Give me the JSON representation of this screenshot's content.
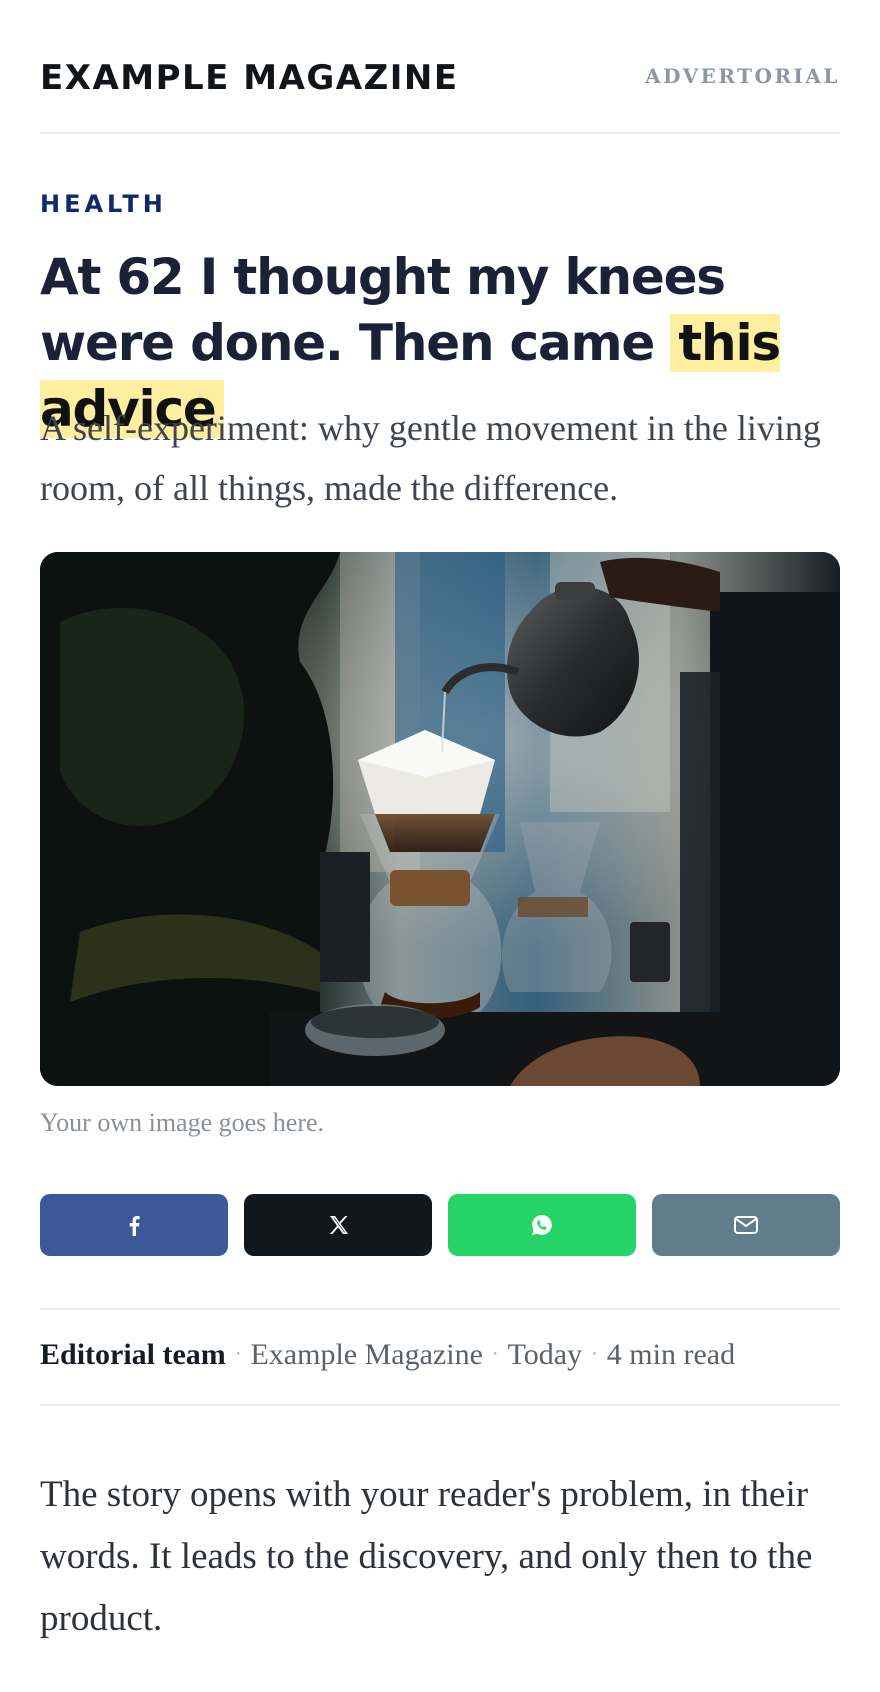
{
  "masthead": {
    "logo": "EXAMPLE MAGAZINE",
    "label": "ADVERTORIAL"
  },
  "article": {
    "kicker": "HEALTH",
    "headline_main": "At 62 I thought my knees were done. Then came",
    "headline_highlight": "this advice",
    "dek": "A self-experiment: why gentle movement in the living room, of all things, made the difference.",
    "caption": "Your own image goes here.",
    "body": "The story opens with your reader's problem, in their words. It leads to the discovery, and only then to the product."
  },
  "share": [
    {
      "icon": "facebook-icon",
      "color": "#3b5998"
    },
    {
      "icon": "x-icon",
      "color": "#12161d"
    },
    {
      "icon": "whatsapp-icon",
      "color": "#25d366"
    },
    {
      "icon": "mail-icon",
      "color": "#607d8b"
    }
  ],
  "byline": {
    "author": "Editorial team",
    "publication": "Example Magazine",
    "date": "Today",
    "read_time": "4 min read"
  },
  "colors": {
    "kicker": "#11286b",
    "headline": "#1b2238",
    "highlight": "#fdeea0"
  }
}
